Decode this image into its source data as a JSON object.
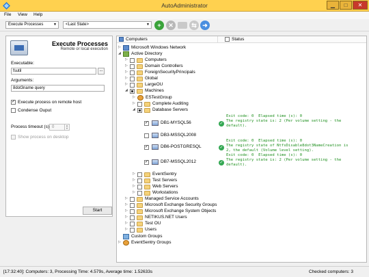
{
  "app": {
    "title": "AutoAdministrator"
  },
  "menu": [
    "File",
    "View",
    "Help"
  ],
  "toolbar": {
    "action_combo": "Execute Processes",
    "state_combo": "<Last State>"
  },
  "left_panel": {
    "title": "Execute Processes",
    "subtitle": "Remote or local execution",
    "executable_label": "Executable:",
    "executable_value": "fsutil",
    "browse_label": "...",
    "arguments_label": "Arguments:",
    "arguments_value": "8dot3name query",
    "execute_remote_label": "Execute process on remote host",
    "execute_remote_checked": true,
    "condense_label": "Condense Ouput",
    "condense_checked": false,
    "timeout_label": "Process timeout (s):",
    "timeout_value": "0",
    "show_desktop_label": "Show process on desktop",
    "show_desktop_checked": false,
    "start_label": "Start"
  },
  "tree": {
    "col_computers": "Computers",
    "col_status": "Status",
    "nodes": {
      "mwn": "Microsoft Windows Network",
      "ad": "Active Directory",
      "computers": "Computers",
      "dc": "Domain Controllers",
      "fsp": "ForeignSecurityPrincipals",
      "global": "Global",
      "largeou": "LargeOU",
      "machines": "Machines",
      "estest": "ESTestGroup",
      "complete": "Complete Auditing",
      "dbservers": "Database Servers",
      "db1": "DB1-MYSQL56",
      "db3": "DB3-MSSQL2008",
      "db6": "DB6-POSTGRESQL",
      "db7": "DB7-MSSQL2012",
      "eventsentry": "EventSentry",
      "testservers": "Test Servers",
      "webservers": "Web Servers",
      "workstations": "Workstations",
      "msa": "Managed Service Accounts",
      "mesg": "Microsoft Exchange Security Groups",
      "meso": "Microsoft Exchange System Objects",
      "netikus": "NETIKUS.NET Users",
      "testou": "Test OU",
      "users": "Users",
      "customgroups": "Custom Groups",
      "esgroups": "EventSentry Groups"
    },
    "status": {
      "db1": "Exit code: 0  Elapsed time (s): 0\nThe registry state is: 2 (Per volume setting - the\ndefault).",
      "db6": "Exit code: 0  Elapsed time (s): 0\nThe registry state of NtfsDisable8dot3NameCreation is\n2, the default (Volume level setting).",
      "db7": "Exit code: 0  Elapsed time (s): 0\nThe registry state is: 2 (Per volume setting - the\ndefault)."
    }
  },
  "statusbar": {
    "left": "[17:32:40]: Computers: 3, Processing Time: 4.579s, Average time: 1.52633s",
    "right": "Checked computers: 3"
  }
}
